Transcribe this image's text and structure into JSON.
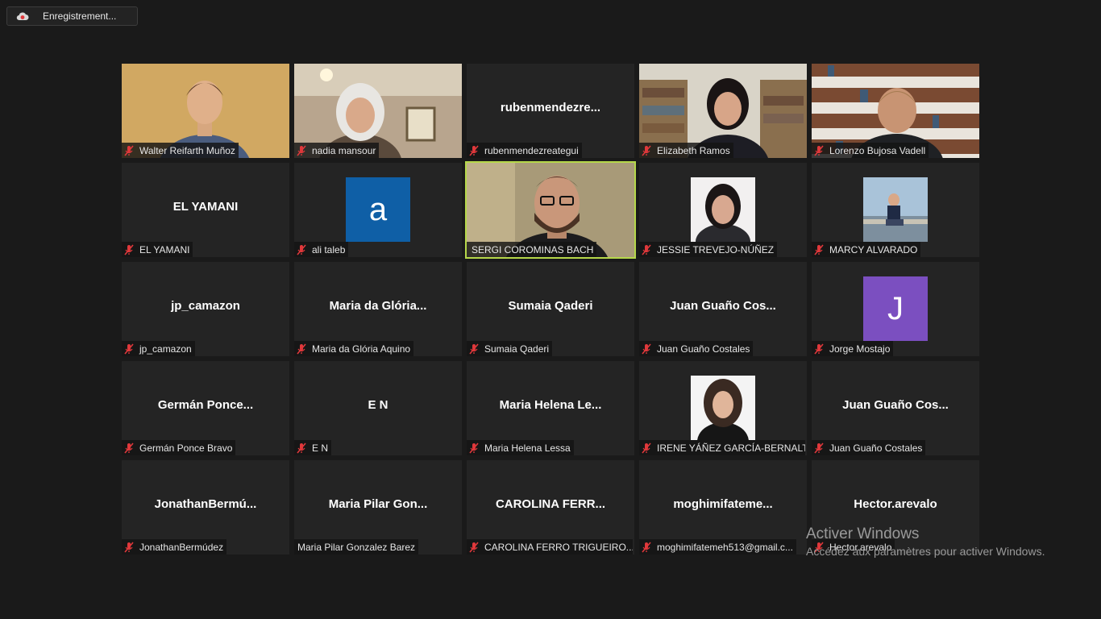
{
  "recording": {
    "label": "Enregistrement..."
  },
  "windows_watermark": {
    "title": "Activer Windows",
    "subtitle": "Accédez aux paramètres pour activer Windows."
  },
  "colors": {
    "active_speaker_border": "#b6d84a",
    "muted_icon": "#e0383b",
    "avatar_blue": "#0f5fa6",
    "avatar_purple": "#7b4fc0"
  },
  "participants": [
    {
      "label": "Walter Reifarth Muñoz",
      "muted": true
    },
    {
      "label": "nadia mansour",
      "muted": true
    },
    {
      "label": "rubenmendezreategui",
      "center": "rubenmendezre...",
      "muted": true
    },
    {
      "label": "Elizabeth Ramos",
      "muted": true
    },
    {
      "label": "Lorenzo Bujosa Vadell",
      "muted": true
    },
    {
      "label": "EL YAMANI",
      "center": "EL YAMANI",
      "muted": true
    },
    {
      "label": "ali taleb",
      "avatar_letter": "a",
      "muted": true
    },
    {
      "label": "SERGI COROMINAS BACH",
      "muted": false,
      "active": true
    },
    {
      "label": "JESSIE TREVEJO-NÚÑEZ",
      "muted": true
    },
    {
      "label": "MARCY ALVARADO",
      "muted": true
    },
    {
      "label": "jp_camazon",
      "center": "jp_camazon",
      "muted": true
    },
    {
      "label": "Maria da Glória Aquino",
      "center": "Maria da Glória...",
      "muted": true
    },
    {
      "label": "Sumaia Qaderi",
      "center": "Sumaia Qaderi",
      "muted": true
    },
    {
      "label": "Juan Guaño Costales",
      "center": "Juan Guaño Cos...",
      "muted": true
    },
    {
      "label": "Jorge Mostajo",
      "avatar_letter": "J",
      "muted": true
    },
    {
      "label": "Germán Ponce Bravo",
      "center": "Germán Ponce...",
      "muted": true
    },
    {
      "label": "E N",
      "center": "E N",
      "muted": true
    },
    {
      "label": "Maria Helena Lessa",
      "center": "Maria Helena Le...",
      "muted": true
    },
    {
      "label": "IRENE YÁÑEZ GARCÍA-BERNALT",
      "muted": true
    },
    {
      "label": "Juan Guaño Costales",
      "center": "Juan Guaño Cos...",
      "muted": true
    },
    {
      "label": "JonathanBermúdez",
      "center": "JonathanBermú...",
      "muted": true
    },
    {
      "label": "Maria Pilar Gonzalez Barez",
      "center": "Maria Pilar Gon...",
      "muted": false
    },
    {
      "label": "CAROLINA FERRO TRIGUEIRO...",
      "center": "CAROLINA FERR...",
      "muted": true
    },
    {
      "label": "moghimifatemeh513@gmail.c...",
      "center": "moghimifateme...",
      "muted": true
    },
    {
      "label": "Hector.arevalo",
      "center": "Hector.arevalo",
      "muted": true
    }
  ]
}
